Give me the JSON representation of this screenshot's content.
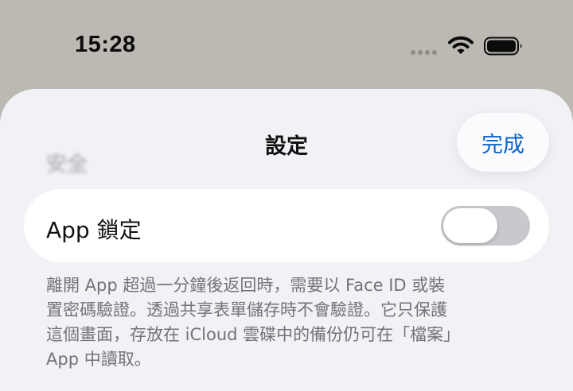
{
  "status_bar": {
    "time": "15:28",
    "icons": [
      "signal-dots-icon",
      "wifi-icon",
      "battery-icon"
    ]
  },
  "sheet": {
    "title": "設定",
    "done_label": "完成",
    "section_header": "安全",
    "row": {
      "label": "App 鎖定",
      "toggle_on": false
    },
    "footer": "離開 App 超過一分鐘後返回時，需要以 Face ID 或裝\n置密碼驗證。透過共享表單儲存時不會驗證。它只保護\n這個畫面，存放在 iCloud 雲碟中的備份仍可在「檔案」\nApp 中讀取。"
  },
  "colors": {
    "backdrop": "#bcb9b2",
    "sheet": "#f2f2f6",
    "accent": "#0b64c9",
    "toggle_off": "#c9c9cd"
  }
}
